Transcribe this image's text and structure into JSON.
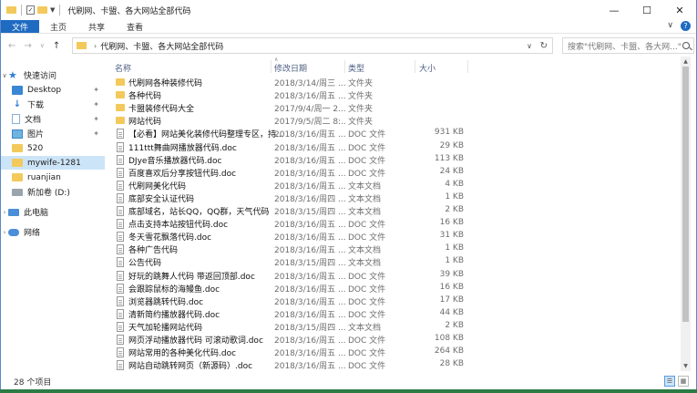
{
  "window": {
    "title": "代刷网、卡盟、各大网站全部代码",
    "minimize": "—",
    "maximize": "☐",
    "close": "✕"
  },
  "ribbon": {
    "tabs": [
      "文件",
      "主页",
      "共享",
      "查看"
    ],
    "expand": "∨",
    "help": "?"
  },
  "nav": {
    "back": "←",
    "forward": "→",
    "recent": "∨",
    "up": "↑"
  },
  "address": {
    "chevron": "›",
    "crumb": "代刷网、卡盟、各大网站全部代码",
    "dropdown": "∨",
    "refresh": "↻"
  },
  "search": {
    "placeholder": "搜索\"代刷网、卡盟、各大网...\""
  },
  "sidebar": {
    "items": [
      {
        "label": "快速访问",
        "icon": "star-icon"
      },
      {
        "label": "Desktop",
        "icon": "desktop-icon",
        "pin": "📌"
      },
      {
        "label": "下载",
        "icon": "download-icon",
        "pin": "📌"
      },
      {
        "label": "文档",
        "icon": "documents-icon",
        "pin": "📌"
      },
      {
        "label": "图片",
        "icon": "pictures-icon",
        "pin": "📌"
      },
      {
        "label": "520",
        "icon": "folder-icon"
      },
      {
        "label": "mywife-1281",
        "icon": "folder-icon"
      },
      {
        "label": "ruanjian",
        "icon": "folder-icon"
      },
      {
        "label": "新加卷 (D:)",
        "icon": "drive-icon"
      },
      {
        "label": "此电脑",
        "icon": "pc-icon"
      },
      {
        "label": "网络",
        "icon": "network-icon"
      }
    ]
  },
  "columns": {
    "name": "名称",
    "date": "修改日期",
    "type": "类型",
    "size": "大小"
  },
  "files": [
    {
      "name": "代刷网各种装修代码",
      "date": "2018/3/14/周三 ...",
      "type": "文件夹",
      "size": "",
      "kind": "folder"
    },
    {
      "name": "各种代码",
      "date": "2018/3/16/周五 ...",
      "type": "文件夹",
      "size": "",
      "kind": "folder"
    },
    {
      "name": "卡盟装修代码大全",
      "date": "2017/9/4/周一 2...",
      "type": "文件夹",
      "size": "",
      "kind": "folder"
    },
    {
      "name": "网站代码",
      "date": "2017/9/5/周二 8:...",
      "type": "文件夹",
      "size": "",
      "kind": "folder"
    },
    {
      "name": "【必看】网站美化装修代码整理专区，持...",
      "date": "2018/3/16/周五 ...",
      "type": "DOC 文件",
      "size": "931 KB",
      "kind": "doc"
    },
    {
      "name": "111ttt舞曲网播放器代码.doc",
      "date": "2018/3/16/周五 ...",
      "type": "DOC 文件",
      "size": "29 KB",
      "kind": "doc"
    },
    {
      "name": "DJye音乐播放器代码.doc",
      "date": "2018/3/16/周五 ...",
      "type": "DOC 文件",
      "size": "113 KB",
      "kind": "doc"
    },
    {
      "name": "百度喜欢后分享按钮代码.doc",
      "date": "2018/3/16/周五 ...",
      "type": "DOC 文件",
      "size": "24 KB",
      "kind": "doc"
    },
    {
      "name": "代刷网美化代码",
      "date": "2018/3/16/周五 ...",
      "type": "文本文档",
      "size": "4 KB",
      "kind": "doc"
    },
    {
      "name": "底部安全认证代码",
      "date": "2018/3/16/周四 ...",
      "type": "文本文档",
      "size": "1 KB",
      "kind": "doc"
    },
    {
      "name": "底部域名，站长QQ，QQ群，天气代码",
      "date": "2018/3/15/周四 ...",
      "type": "文本文档",
      "size": "2 KB",
      "kind": "doc"
    },
    {
      "name": "点击支持本站按钮代码.doc",
      "date": "2018/3/16/周五 ...",
      "type": "DOC 文件",
      "size": "16 KB",
      "kind": "doc"
    },
    {
      "name": "冬天雪花飘落代码.doc",
      "date": "2018/3/16/周五 ...",
      "type": "DOC 文件",
      "size": "31 KB",
      "kind": "doc"
    },
    {
      "name": "各种广告代码",
      "date": "2018/3/16/周五 ...",
      "type": "文本文档",
      "size": "1 KB",
      "kind": "doc"
    },
    {
      "name": "公告代码",
      "date": "2018/3/15/周四 ...",
      "type": "文本文档",
      "size": "1 KB",
      "kind": "doc"
    },
    {
      "name": "好玩的跳舞人代码 带返回顶部.doc",
      "date": "2018/3/16/周五 ...",
      "type": "DOC 文件",
      "size": "39 KB",
      "kind": "doc"
    },
    {
      "name": "会跟踪鼠标的海鳗鱼.doc",
      "date": "2018/3/16/周五 ...",
      "type": "DOC 文件",
      "size": "16 KB",
      "kind": "doc"
    },
    {
      "name": "浏览器跳转代码.doc",
      "date": "2018/3/16/周五 ...",
      "type": "DOC 文件",
      "size": "17 KB",
      "kind": "doc"
    },
    {
      "name": "清新简约播放器代码.doc",
      "date": "2018/3/16/周五 ...",
      "type": "DOC 文件",
      "size": "44 KB",
      "kind": "doc"
    },
    {
      "name": "天气加轮播网站代码",
      "date": "2018/3/15/周四 ...",
      "type": "文本文档",
      "size": "2 KB",
      "kind": "doc"
    },
    {
      "name": "网页浮动播放器代码 可滚动歌词.doc",
      "date": "2018/3/16/周五 ...",
      "type": "DOC 文件",
      "size": "108 KB",
      "kind": "doc"
    },
    {
      "name": "网站常用的各种美化代码.doc",
      "date": "2018/3/16/周五 ...",
      "type": "DOC 文件",
      "size": "264 KB",
      "kind": "doc"
    },
    {
      "name": "网站自动跳转网页（新源码）.doc",
      "date": "2018/3/16/周五 ...",
      "type": "DOC 文件",
      "size": "28 KB",
      "kind": "doc"
    }
  ],
  "status": {
    "count": "28 个项目"
  },
  "scrollbar": {
    "up": "▲",
    "down": "▼"
  }
}
